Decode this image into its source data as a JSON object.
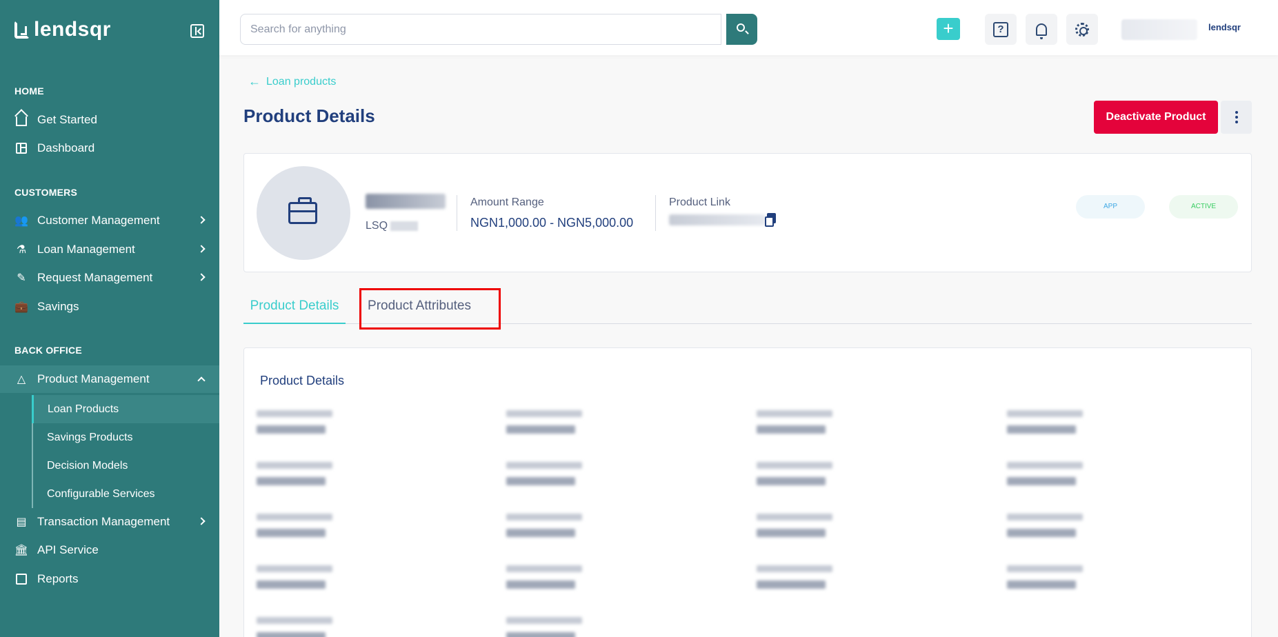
{
  "brand": {
    "name": "lendsqr",
    "mini": "lendsqr"
  },
  "sidebar": {
    "sections": [
      "HOME",
      "CUSTOMERS",
      "BACK OFFICE"
    ],
    "home": [
      {
        "label": "Get Started",
        "icon": "home-icon"
      },
      {
        "label": "Dashboard",
        "icon": "dashboard-icon"
      }
    ],
    "customers": [
      {
        "label": "Customer Management",
        "icon": "users-icon"
      },
      {
        "label": "Loan Management",
        "icon": "loan-icon"
      },
      {
        "label": "Request Management",
        "icon": "request-icon"
      },
      {
        "label": "Savings",
        "icon": "briefcase-icon"
      }
    ],
    "back_office": [
      {
        "label": "Product Management",
        "icon": "product-icon"
      },
      {
        "label": "Transaction Management",
        "icon": "transaction-icon"
      },
      {
        "label": "API Service",
        "icon": "bank-icon"
      },
      {
        "label": "Reports",
        "icon": "reports-icon"
      }
    ],
    "product_sub": [
      "Loan Products",
      "Savings Products",
      "Decision Models",
      "Configurable Services"
    ]
  },
  "topbar": {
    "search_placeholder": "Search for anything",
    "plus": "+"
  },
  "page": {
    "back_label": "Loan products",
    "title": "Product Details",
    "deactivate_label": "Deactivate Product"
  },
  "product": {
    "code_prefix": "LSQ",
    "amount_label": "Amount Range",
    "amount_value": "NGN1,000.00 - NGN5,000.00",
    "link_label": "Product Link",
    "badge_app": "APP",
    "badge_active": "ACTIVE"
  },
  "tabs": [
    "Product Details",
    "Product Attributes"
  ],
  "details": {
    "title": "Product Details"
  },
  "colors": {
    "sidebar": "#2e7a7a",
    "accent": "#39cdcc",
    "danger": "#e4033b",
    "navy": "#213f7d"
  }
}
